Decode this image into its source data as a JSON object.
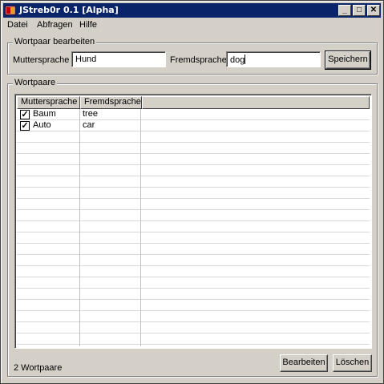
{
  "window": {
    "title": "JStreb0r 0.1 [Alpha]",
    "controls": {
      "minimize": "_",
      "maximize": "□",
      "close": "✕"
    }
  },
  "menu": [
    {
      "label": "Datei"
    },
    {
      "label": "Abfragen"
    },
    {
      "label": "Hilfe"
    }
  ],
  "edit_group": {
    "title": "Wortpaar bearbeiten",
    "native_label": "Muttersprache",
    "native_value": "Hund",
    "foreign_label": "Fremdsprache",
    "foreign_value": "dog",
    "save_label": "Speichern"
  },
  "pairs_group": {
    "title": "Wortpaare",
    "columns": [
      "Muttersprache",
      "Fremdsprache"
    ],
    "rows": [
      {
        "checked": true,
        "native": "Baum",
        "foreign": "tree"
      },
      {
        "checked": true,
        "native": "Auto",
        "foreign": "car"
      }
    ]
  },
  "footer": {
    "status": "2 Wortpaare",
    "edit_label": "Bearbeiten",
    "delete_label": "Löschen"
  },
  "colors": {
    "titlebar": "#0a246a",
    "face": "#d4d0c8"
  }
}
